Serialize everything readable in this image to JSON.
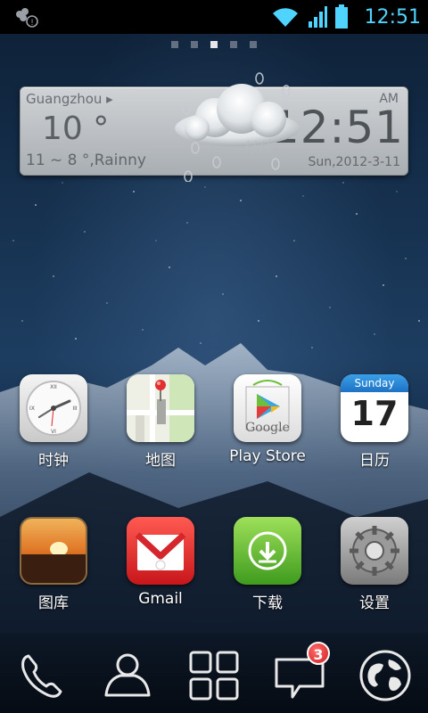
{
  "status_bar": {
    "time": "12:51",
    "icons": [
      "clover-icon",
      "info-icon",
      "wifi-icon",
      "signal-icon",
      "battery-icon"
    ]
  },
  "pager": {
    "pages": 5,
    "active_index": 2
  },
  "weather_widget": {
    "city": "Guangzhou ▸",
    "temperature": "10 °",
    "range": "11 ~ 8 °,Rainny",
    "ampm": "AM",
    "clock": "12:51",
    "date": "Sun,2012-3-11"
  },
  "apps": [
    {
      "label": "时钟",
      "icon": "clock-icon"
    },
    {
      "label": "地图",
      "icon": "map-icon"
    },
    {
      "label": "Play Store",
      "icon": "play-store-icon"
    },
    {
      "label": "日历",
      "icon": "calendar-icon",
      "calendar_day": "Sunday",
      "calendar_date": "17"
    },
    {
      "label": "图库",
      "icon": "gallery-icon"
    },
    {
      "label": "Gmail",
      "icon": "gmail-icon"
    },
    {
      "label": "下载",
      "icon": "download-icon"
    },
    {
      "label": "设置",
      "icon": "settings-icon"
    }
  ],
  "play_store_logo_text": "Google",
  "dock": [
    {
      "icon": "phone-icon"
    },
    {
      "icon": "contacts-icon"
    },
    {
      "icon": "app-drawer-icon"
    },
    {
      "icon": "messages-icon",
      "badge": "3"
    },
    {
      "icon": "browser-globe-icon"
    }
  ],
  "colors": {
    "status_accent": "#4fd3ff",
    "badge_red": "#d31e1e"
  }
}
